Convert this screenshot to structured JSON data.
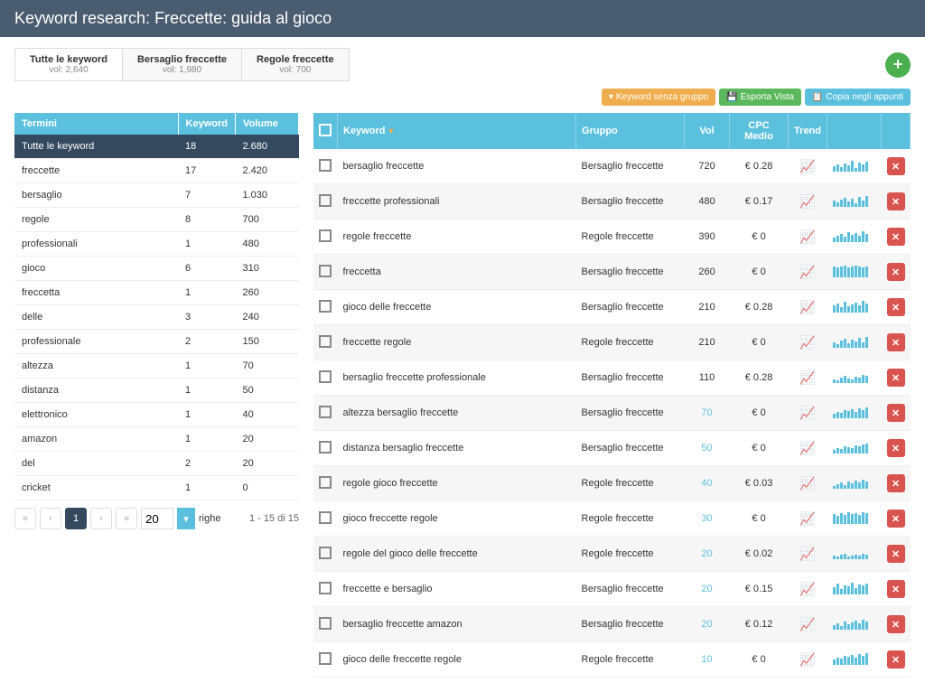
{
  "header": {
    "title": "Keyword research: Freccette: guida al gioco"
  },
  "tabs": [
    {
      "title": "Tutte le keyword",
      "sub": "vol: 2,640",
      "active": true
    },
    {
      "title": "Bersaglio freccette",
      "sub": "vol: 1,980",
      "active": false
    },
    {
      "title": "Regole freccette",
      "sub": "vol: 700",
      "active": false
    }
  ],
  "toolbar": {
    "noGroup": "Keyword senza gruppo",
    "export": "Esporta Vista",
    "copy": "Copia negli appunti"
  },
  "leftHeaders": {
    "term": "Termini",
    "kw": "Keyword",
    "vol": "Volume"
  },
  "leftRows": [
    {
      "term": "Tutte le keyword",
      "kw": "18",
      "vol": "2.680",
      "sel": true
    },
    {
      "term": "freccette",
      "kw": "17",
      "vol": "2.420"
    },
    {
      "term": "bersaglio",
      "kw": "7",
      "vol": "1.030"
    },
    {
      "term": "regole",
      "kw": "8",
      "vol": "700"
    },
    {
      "term": "professionali",
      "kw": "1",
      "vol": "480"
    },
    {
      "term": "gioco",
      "kw": "6",
      "vol": "310"
    },
    {
      "term": "freccetta",
      "kw": "1",
      "vol": "260"
    },
    {
      "term": "delle",
      "kw": "3",
      "vol": "240"
    },
    {
      "term": "professionale",
      "kw": "2",
      "vol": "150"
    },
    {
      "term": "altezza",
      "kw": "1",
      "vol": "70"
    },
    {
      "term": "distanza",
      "kw": "1",
      "vol": "50"
    },
    {
      "term": "elettronico",
      "kw": "1",
      "vol": "40"
    },
    {
      "term": "amazon",
      "kw": "1",
      "vol": "20"
    },
    {
      "term": "del",
      "kw": "2",
      "vol": "20"
    },
    {
      "term": "cricket",
      "kw": "1",
      "vol": "0"
    }
  ],
  "pager": {
    "size": "20",
    "label": "righe",
    "info": "1 - 15 di 15"
  },
  "rightHeaders": {
    "kw": "Keyword",
    "grp": "Gruppo",
    "vol": "Vol",
    "cpc": "CPC Medio",
    "trend": "Trend"
  },
  "rightRows": [
    {
      "kw": "bersaglio freccette",
      "grp": "Bersaglio freccette",
      "vol": "720",
      "cpc": "€ 0.28",
      "spark": [
        6,
        8,
        5,
        9,
        7,
        12,
        4,
        10,
        8,
        11
      ]
    },
    {
      "kw": "freccette professionali",
      "grp": "Bersaglio freccette",
      "vol": "480",
      "cpc": "€ 0.17",
      "spark": [
        7,
        5,
        8,
        10,
        6,
        9,
        4,
        11,
        7,
        12
      ]
    },
    {
      "kw": "regole freccette",
      "grp": "Regole freccette",
      "vol": "390",
      "cpc": "€ 0",
      "spark": [
        5,
        7,
        9,
        6,
        11,
        8,
        10,
        7,
        12,
        9
      ]
    },
    {
      "kw": "freccetta",
      "grp": "Bersaglio freccette",
      "vol": "260",
      "cpc": "€ 0",
      "spark": [
        12,
        11,
        12,
        13,
        11,
        12,
        13,
        12,
        11,
        12
      ]
    },
    {
      "kw": "gioco delle freccette",
      "grp": "Bersaglio freccette",
      "vol": "210",
      "cpc": "€ 0.28",
      "spark": [
        8,
        10,
        6,
        12,
        7,
        9,
        11,
        8,
        13,
        10
      ]
    },
    {
      "kw": "freccette regole",
      "grp": "Regole freccette",
      "vol": "210",
      "cpc": "€ 0",
      "spark": [
        6,
        4,
        8,
        10,
        5,
        9,
        7,
        11,
        6,
        12
      ]
    },
    {
      "kw": "bersaglio freccette professionale",
      "grp": "Bersaglio freccette",
      "vol": "110",
      "cpc": "€ 0.28",
      "spark": [
        4,
        3,
        6,
        8,
        5,
        4,
        7,
        6,
        9,
        8
      ]
    },
    {
      "kw": "altezza bersaglio freccette",
      "grp": "Bersaglio freccette",
      "vol": "70",
      "cpc": "€ 0",
      "low": true,
      "spark": [
        5,
        7,
        6,
        9,
        8,
        10,
        7,
        11,
        9,
        12
      ]
    },
    {
      "kw": "distanza bersaglio freccette",
      "grp": "Bersaglio freccette",
      "vol": "50",
      "cpc": "€ 0",
      "low": true,
      "spark": [
        4,
        6,
        5,
        8,
        7,
        6,
        9,
        8,
        10,
        11
      ]
    },
    {
      "kw": "regole gioco freccette",
      "grp": "Regole freccette",
      "vol": "40",
      "cpc": "€ 0.03",
      "low": true,
      "spark": [
        3,
        5,
        7,
        4,
        8,
        6,
        9,
        7,
        10,
        8
      ]
    },
    {
      "kw": "gioco freccette regole",
      "grp": "Regole freccette",
      "vol": "30",
      "cpc": "€ 0",
      "low": true,
      "spark": [
        11,
        9,
        12,
        10,
        13,
        11,
        12,
        10,
        13,
        12
      ]
    },
    {
      "kw": "regole del gioco delle freccette",
      "grp": "Regole freccette",
      "vol": "20",
      "cpc": "€ 0.02",
      "low": true,
      "spark": [
        4,
        3,
        5,
        6,
        3,
        4,
        5,
        4,
        6,
        5
      ]
    },
    {
      "kw": "freccette e bersaglio",
      "grp": "Bersaglio freccette",
      "vol": "20",
      "cpc": "€ 0.15",
      "low": true,
      "spark": [
        8,
        12,
        6,
        10,
        9,
        13,
        7,
        11,
        10,
        12
      ]
    },
    {
      "kw": "bersaglio freccette amazon",
      "grp": "Bersaglio freccette",
      "vol": "20",
      "cpc": "€ 0.12",
      "low": true,
      "spark": [
        5,
        7,
        4,
        9,
        6,
        8,
        10,
        7,
        11,
        9
      ]
    },
    {
      "kw": "gioco delle freccette regole",
      "grp": "Regole freccette",
      "vol": "10",
      "cpc": "€ 0",
      "low": true,
      "spark": [
        6,
        8,
        7,
        10,
        9,
        11,
        8,
        12,
        10,
        13
      ]
    }
  ]
}
